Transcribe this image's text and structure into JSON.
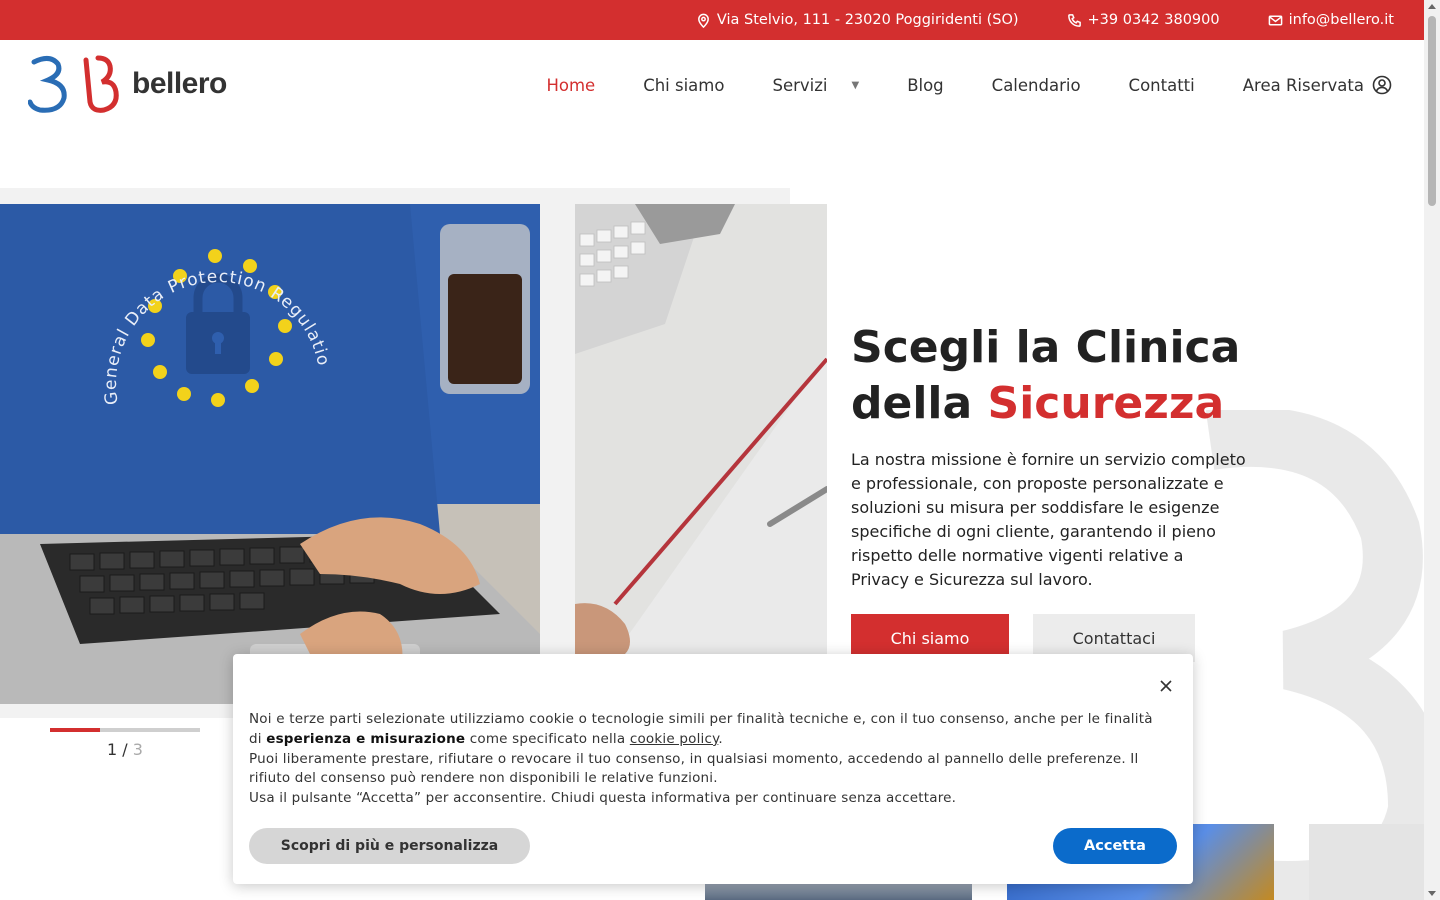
{
  "topbar": {
    "address": "Via Stelvio, 111 - 23020 Poggiridenti (SO)",
    "phone": "+39 0342 380900",
    "email": "info@bellero.it"
  },
  "header": {
    "logo_text": "bellero",
    "nav": [
      {
        "label": "Home",
        "active": true
      },
      {
        "label": "Chi siamo"
      },
      {
        "label": "Servizi",
        "has_dropdown": true
      },
      {
        "label": "Blog"
      },
      {
        "label": "Calendario"
      },
      {
        "label": "Contatti"
      },
      {
        "label": "Area Riservata"
      }
    ]
  },
  "hero": {
    "title_line1": "Scegli la Clinica",
    "title_line2_plain": "della ",
    "title_line2_accent": "Sicurezza",
    "description": "La nostra missione è fornire un servizio completo e professionale, con proposte personalizzate e soluzioni su misura per soddisfare le esigenze specifiche di ogni cliente, garantendo il pieno rispetto delle normative vigenti relative a Privacy e Sicurezza sul lavoro.",
    "btn_primary": "Chi siamo",
    "btn_secondary": "Contattaci",
    "image1_text": "General Data Protection Regulation (GDPR)",
    "slider": {
      "current": "1",
      "separator": "/",
      "total": "3",
      "progress": 0.33
    }
  },
  "cookie": {
    "text_p1_before": "Noi e terze parti selezionate utilizziamo cookie o tecnologie simili per finalità tecniche e, con il tuo consenso, anche per le finalità di ",
    "text_p1_bold": "esperienza e misurazione",
    "text_p1_mid": " come specificato nella ",
    "text_p1_link": "cookie policy",
    "text_p1_end": ".",
    "text_p2": "Puoi liberamente prestare, rifiutare o revocare il tuo consenso, in qualsiasi momento, accedendo al pannello delle preferenze. Il rifiuto del consenso può rendere non disponibili le relative funzioni.",
    "text_p3": "Usa il pulsante “Accetta” per acconsentire. Chiudi questa informativa per continuare senza accettare.",
    "btn_more": "Scopri di più e personalizza",
    "btn_accept": "Accetta"
  },
  "colors": {
    "brand_red": "#d32f2f",
    "accept_blue": "#0b6bcb",
    "logo_blue": "#2a6db5"
  }
}
